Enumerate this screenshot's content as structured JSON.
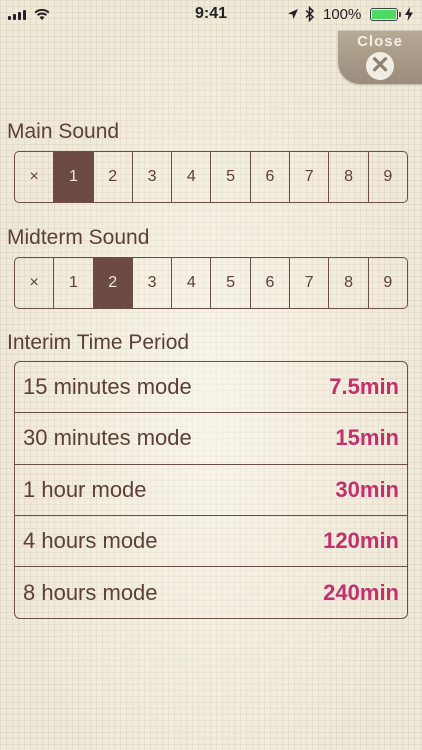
{
  "status_bar": {
    "time": "9:41",
    "battery_percent": "100%",
    "battery_level": 1.0,
    "icons": [
      "signal-icon",
      "wifi-icon",
      "location-icon",
      "bluetooth-icon",
      "battery-icon",
      "charging-icon"
    ]
  },
  "close_button": {
    "label": "Close",
    "icon": "close-icon",
    "icon_glyph": "✕"
  },
  "main_sound": {
    "label": "Main Sound",
    "options": [
      "×",
      "1",
      "2",
      "3",
      "4",
      "5",
      "6",
      "7",
      "8",
      "9"
    ],
    "selected": "1"
  },
  "midterm_sound": {
    "label": "Midterm Sound",
    "options": [
      "×",
      "1",
      "2",
      "3",
      "4",
      "5",
      "6",
      "7",
      "8",
      "9"
    ],
    "selected": "2"
  },
  "interim_period": {
    "label": "Interim Time Period",
    "rows": [
      {
        "name": "15 minutes mode",
        "value": "7.5min"
      },
      {
        "name": "30 minutes mode",
        "value": "15min"
      },
      {
        "name": "1 hour mode",
        "value": "30min"
      },
      {
        "name": "4 hours mode",
        "value": "120min"
      },
      {
        "name": "8 hours mode",
        "value": "240min"
      }
    ]
  },
  "colors": {
    "background": "#efe9d8",
    "text": "#5a4038",
    "selected_segment": "#6e4a44",
    "value_accent": "#c2306e",
    "close_button": "#a89b88"
  }
}
